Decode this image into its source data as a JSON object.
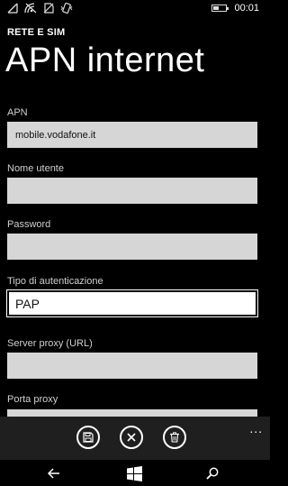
{
  "status_bar": {
    "icons": [
      "signal-none-icon",
      "wifi-icon",
      "sim-off-icon",
      "vibrate-icon"
    ],
    "time": "00:01",
    "battery_level": 0.4
  },
  "header": {
    "section": "RETE E SIM",
    "title": "APN internet"
  },
  "fields": {
    "apn": {
      "label": "APN",
      "value": "mobile.vodafone.it"
    },
    "username": {
      "label": "Nome utente",
      "value": ""
    },
    "password": {
      "label": "Password",
      "value": ""
    },
    "auth_type": {
      "label": "Tipo di autenticazione",
      "value": "PAP"
    },
    "proxy_server": {
      "label": "Server proxy (URL)",
      "value": ""
    },
    "proxy_port": {
      "label": "Porta proxy",
      "value": ""
    }
  },
  "app_bar": {
    "buttons": [
      "save-icon",
      "cancel-icon",
      "delete-icon"
    ],
    "more": "..."
  },
  "nav_bar": {
    "buttons": [
      "back-icon",
      "windows-start-icon",
      "search-icon"
    ]
  }
}
